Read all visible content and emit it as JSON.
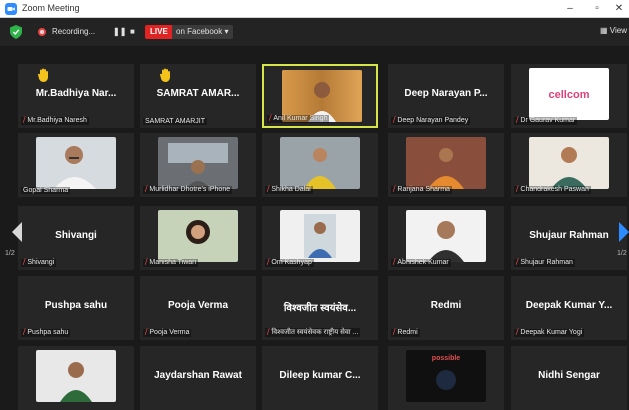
{
  "window": {
    "title": "Zoom Meeting"
  },
  "toolbar": {
    "recording_label": "Recording...",
    "pause_glyph": "❚❚",
    "stop_glyph": "■",
    "live_label": "LIVE",
    "live_destination": "on Facebook ▾",
    "view_label": "View"
  },
  "pagination": {
    "left": "1/2",
    "right": "1/2"
  },
  "colors": {
    "active_speaker": "#d6e64a",
    "live": "#e02424",
    "raised_hand": "#f3c21b"
  },
  "tiles": [
    {
      "display_name": "Mr.Badhiya Nar...",
      "tag": "Mr.Badhiya Naresh",
      "muted": true,
      "hand": true
    },
    {
      "display_name": "SAMRAT AMAR...",
      "tag": "SAMRAT AMARJIT",
      "muted": false,
      "hand": true
    },
    {
      "display_name": "",
      "tag": "Anil Kumar Singh",
      "muted": true,
      "video": "speaker"
    },
    {
      "display_name": "Deep Narayan P...",
      "tag": "Deep Narayan Pandey",
      "muted": true
    },
    {
      "display_name": "",
      "tag": "Dr Gaurav Kumar",
      "muted": true,
      "video": "logo",
      "logo_text": "cellcom"
    },
    {
      "display_name": "",
      "tag": "Gopal Sharma",
      "muted": false,
      "video": "man_mustache"
    },
    {
      "display_name": "",
      "tag": "Murlidhar Dhotre's iPhone",
      "muted": true,
      "video": "car_man"
    },
    {
      "display_name": "",
      "tag": "Shikha Dalal",
      "muted": true,
      "video": "woman_yellow"
    },
    {
      "display_name": "",
      "tag": "Ranjana Sharma",
      "muted": true,
      "video": "woman_saree"
    },
    {
      "display_name": "",
      "tag": "Chandrakesh Paswan",
      "muted": true,
      "video": "young_man"
    },
    {
      "display_name": "Shivangi",
      "tag": "Shivangi",
      "muted": true
    },
    {
      "display_name": "",
      "tag": "Manisha Tiwari",
      "muted": true,
      "video": "woman_hair"
    },
    {
      "display_name": "",
      "tag": "Om Kashyap",
      "muted": true,
      "video": "man_photo"
    },
    {
      "display_name": "",
      "tag": "Abhishek Kumar",
      "muted": true,
      "video": "man_portrait"
    },
    {
      "display_name": "Shujaur Rahman",
      "tag": "Shujaur Rahman",
      "muted": true
    },
    {
      "display_name": "Pushpa sahu",
      "tag": "Pushpa sahu",
      "muted": true
    },
    {
      "display_name": "Pooja Verma",
      "tag": "Pooja Verma",
      "muted": true
    },
    {
      "display_name": "विश्वजीत स्वयंसेव...",
      "tag": "विश्वजीत स्वयंसेवक राष्ट्रीय सेवा ...",
      "muted": true
    },
    {
      "display_name": "Redmi",
      "tag": "Redmi",
      "muted": true
    },
    {
      "display_name": "Deepak Kumar Y...",
      "tag": "Deepak Kumar Yogi",
      "muted": true
    },
    {
      "display_name": "",
      "tag": "",
      "muted": false,
      "video": "man_flag"
    },
    {
      "display_name": "Jaydarshan Rawat",
      "tag": "",
      "muted": false
    },
    {
      "display_name": "Dileep kumar C...",
      "tag": "",
      "muted": false
    },
    {
      "display_name": "",
      "tag": "",
      "muted": false,
      "video": "dark_poster",
      "logo_text": "possible"
    },
    {
      "display_name": "Nidhi Sengar",
      "tag": "",
      "muted": false
    }
  ]
}
